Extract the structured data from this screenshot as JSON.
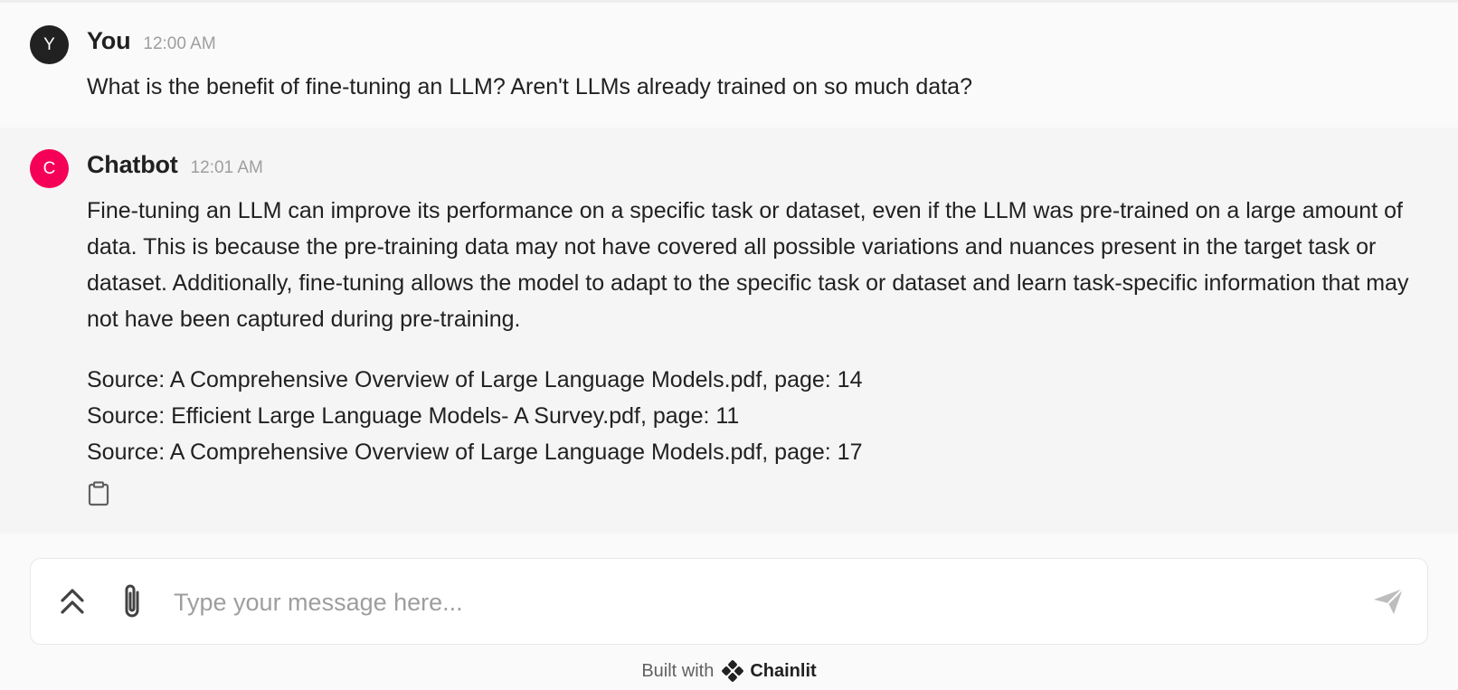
{
  "colors": {
    "user_avatar": "#212121",
    "bot_avatar": "#F50057",
    "user_bg": "#FAFAFA",
    "bot_bg": "#F5F5F5"
  },
  "messages": [
    {
      "avatar_letter": "Y",
      "author": "You",
      "time": "12:00 AM",
      "text": "What is the benefit of fine-tuning an LLM? Aren't LLMs already trained on so much data?"
    },
    {
      "avatar_letter": "C",
      "author": "Chatbot",
      "time": "12:01 AM",
      "paragraph": "Fine-tuning an LLM can improve its performance on a specific task or dataset, even if the LLM was pre-trained on a large amount of data. This is because the pre-training data may not have covered all possible variations and nuances present in the target task or dataset. Additionally, fine-tuning allows the model to adapt to the specific task or dataset and learn task-specific information that may not have been captured during pre-training.",
      "sources": [
        "Source: A Comprehensive Overview of Large Language Models.pdf, page: 14",
        "Source: Efficient Large Language Models- A Survey.pdf, page: 11",
        "Source: A Comprehensive Overview of Large Language Models.pdf, page: 17"
      ],
      "actions": {
        "copy_icon": "clipboard-icon"
      }
    }
  ],
  "composer": {
    "placeholder": "Type your message here...",
    "value": "",
    "icons": {
      "history": "double-chevron-up-icon",
      "attach": "paperclip-icon",
      "send": "send-icon"
    }
  },
  "footer": {
    "prefix": "Built with",
    "brand": "Chainlit",
    "brand_icon": "chainlit-logo-icon"
  }
}
